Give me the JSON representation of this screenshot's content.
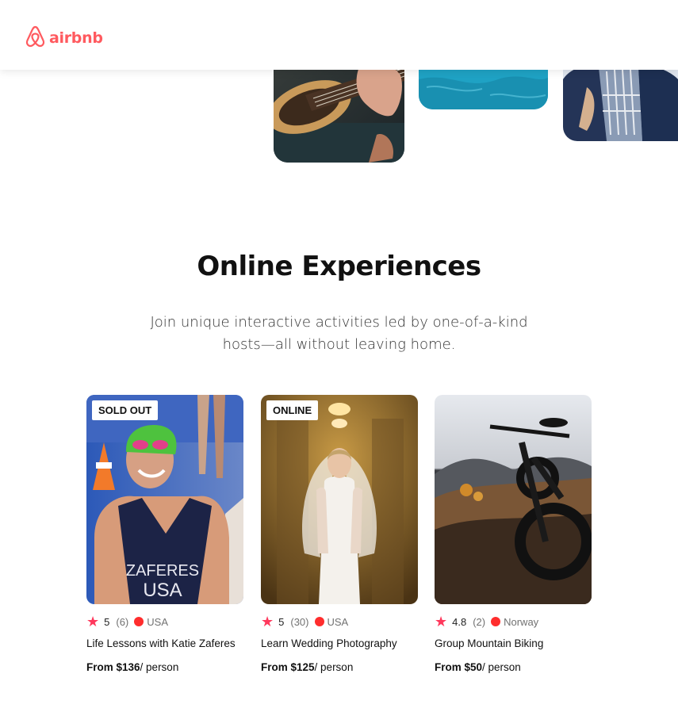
{
  "header": {
    "logo_text": "airbnb"
  },
  "colors": {
    "brand": "#ff5a5f",
    "star": "#ff385c",
    "dot": "#ff2d2d"
  },
  "hero": {
    "tiles": [
      {
        "name": "guitar-photo"
      },
      {
        "name": "pool-photo"
      },
      {
        "name": "jacket-photo"
      }
    ]
  },
  "section": {
    "title": "Online Experiences",
    "subtitle": "Join unique interactive activities led by one-of-a-kind hosts—all without leaving home."
  },
  "cards": [
    {
      "badge": "SOLD OUT",
      "rating": "5",
      "count": "(6)",
      "country": "USA",
      "title": "Life Lessons with Katie Zaferes",
      "price": "From $136",
      "price_unit": "/ person"
    },
    {
      "badge": "ONLINE",
      "rating": "5",
      "count": "(30)",
      "country": "USA",
      "title": "Learn Wedding Photography",
      "price": "From $125",
      "price_unit": "/ person"
    },
    {
      "badge": "",
      "rating": "4.8",
      "count": "(2)",
      "country": "Norway",
      "title": "Group Mountain Biking",
      "price": "From $50",
      "price_unit": "/ person"
    }
  ],
  "photo_text": {
    "jersey_line1": "ZAFERES",
    "jersey_line2": "USA"
  }
}
